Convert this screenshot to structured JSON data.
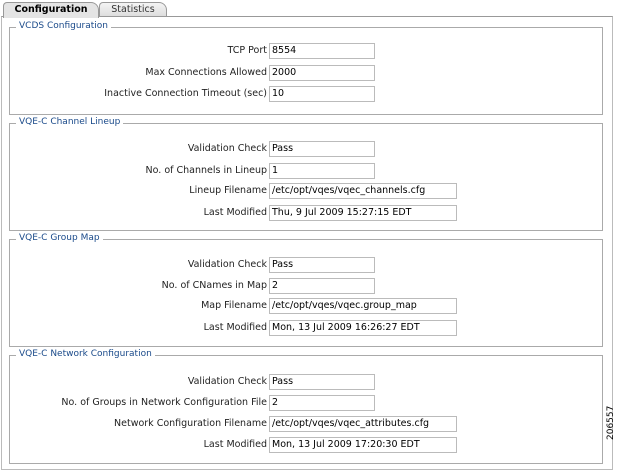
{
  "tabs": [
    "Configuration",
    "Statistics"
  ],
  "sections": [
    {
      "title": "VCDS Configuration",
      "rows": [
        {
          "label": "TCP Port",
          "value": "8554"
        },
        {
          "label": "Max Connections Allowed",
          "value": "2000"
        },
        {
          "label": "Inactive Connection Timeout (sec)",
          "value": "10"
        }
      ]
    },
    {
      "title": "VQE-C Channel Lineup",
      "rows": [
        {
          "label": "Validation Check",
          "value": "Pass"
        },
        {
          "label": "No. of Channels in Lineup",
          "value": "1"
        },
        {
          "label": "Lineup Filename",
          "value": "/etc/opt/vqes/vqec_channels.cfg"
        },
        {
          "label": "Last Modified",
          "value": "Thu, 9 Jul 2009 15:27:15 EDT"
        }
      ]
    },
    {
      "title": "VQE-C Group Map",
      "rows": [
        {
          "label": "Validation Check",
          "value": "Pass"
        },
        {
          "label": "No. of CNames in Map",
          "value": "2"
        },
        {
          "label": "Map Filename",
          "value": "/etc/opt/vqes/vqec.group_map"
        },
        {
          "label": "Last Modified",
          "value": "Mon, 13 Jul 2009 16:26:27 EDT"
        }
      ]
    },
    {
      "title": "VQE-C Network Configuration",
      "rows": [
        {
          "label": "Validation Check",
          "value": "Pass"
        },
        {
          "label": "No. of Groups in Network Configuration File",
          "value": "2"
        },
        {
          "label": "Network Configuration Filename",
          "value": "/etc/opt/vqes/vqec_attributes.cfg"
        },
        {
          "label": "Last Modified",
          "value": "Mon, 13 Jul 2009 17:20:30 EDT"
        }
      ]
    }
  ],
  "figure_id": "206557"
}
